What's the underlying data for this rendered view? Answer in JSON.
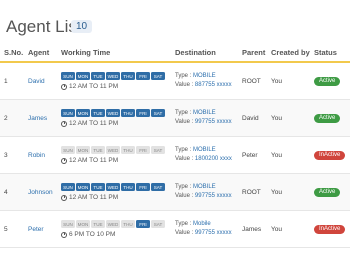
{
  "header": {
    "title": "Agent List",
    "count": "10"
  },
  "columns": [
    "S.No.",
    "Agent",
    "Working Time",
    "Destination",
    "Parent",
    "Created by",
    "Status"
  ],
  "day_labels": [
    "SUN",
    "MON",
    "TUE",
    "WED",
    "THU",
    "FRI",
    "SAT"
  ],
  "labels": {
    "type": "Type : ",
    "value": "Value : "
  },
  "colors": {
    "accent": "#2f6da6",
    "active": "#3e9b44",
    "inactive": "#d0453c",
    "header_rule": "#f2c94c"
  },
  "rows": [
    {
      "sno": "1",
      "agent": "David",
      "days_on": [
        true,
        true,
        true,
        true,
        true,
        true,
        true
      ],
      "time": "12  AM TO 11  PM",
      "dest_type": "MOBILE",
      "dest_value": "887755 xxxxx",
      "parent": "ROOT",
      "created_by": "You",
      "status": "Active"
    },
    {
      "sno": "2",
      "agent": "James",
      "days_on": [
        true,
        true,
        true,
        true,
        true,
        true,
        true
      ],
      "time": "12  AM TO 11  PM",
      "dest_type": "MOBILE",
      "dest_value": "997755 xxxxx",
      "parent": "David",
      "created_by": "You",
      "status": "Active"
    },
    {
      "sno": "3",
      "agent": "Robin",
      "days_on": [
        false,
        false,
        false,
        false,
        false,
        false,
        false
      ],
      "time": "12  AM TO 11  PM",
      "dest_type": "MOBILE",
      "dest_value": "1800200 xxxx",
      "parent": "Peter",
      "created_by": "You",
      "status": "InActive"
    },
    {
      "sno": "4",
      "agent": "Johnson",
      "days_on": [
        true,
        true,
        true,
        true,
        true,
        true,
        true
      ],
      "time": "12  AM TO 11  PM",
      "dest_type": "MOBILE",
      "dest_value": "997755 xxxxx",
      "parent": "ROOT",
      "created_by": "You",
      "status": "Active"
    },
    {
      "sno": "5",
      "agent": "Peter",
      "days_on": [
        false,
        false,
        false,
        false,
        false,
        true,
        false
      ],
      "time": "6  PM TO 10  PM",
      "dest_type": "Mobile",
      "dest_value": "997755 xxxxx",
      "parent": "James",
      "created_by": "You",
      "status": "InActive"
    }
  ]
}
